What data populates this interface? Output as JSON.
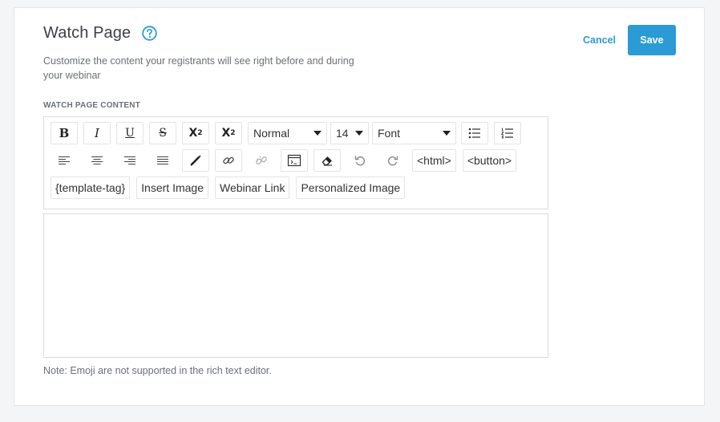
{
  "header": {
    "title": "Watch Page",
    "subtitle": "Customize the content your registrants will see right before and during your webinar"
  },
  "actions": {
    "cancel_label": "Cancel",
    "save_label": "Save"
  },
  "section": {
    "label": "WATCH PAGE CONTENT"
  },
  "toolbar": {
    "format_select": "Normal",
    "size_select": "14",
    "font_select": "Font",
    "html_label": "<html>",
    "button_label": "<button>",
    "template_tag_label": "{template-tag}",
    "insert_image_label": "Insert Image",
    "webinar_link_label": "Webinar Link",
    "personalized_image_label": "Personalized Image",
    "icons": [
      "bold-icon",
      "italic-icon",
      "underline-icon",
      "strikethrough-icon",
      "superscript-icon",
      "subscript-icon",
      "bullet-list-icon",
      "numbered-list-icon",
      "align-left-icon",
      "align-center-icon",
      "align-right-icon",
      "align-justify-icon",
      "pen-icon",
      "link-icon",
      "unlink-icon",
      "source-icon",
      "eraser-icon",
      "undo-icon",
      "redo-icon"
    ]
  },
  "editor": {
    "value": ""
  },
  "note": "Note: Emoji are not supported in the rich text editor.",
  "colors": {
    "accent": "#2a9bd4",
    "border": "#d9dbde",
    "muted_text": "#6b7078"
  }
}
